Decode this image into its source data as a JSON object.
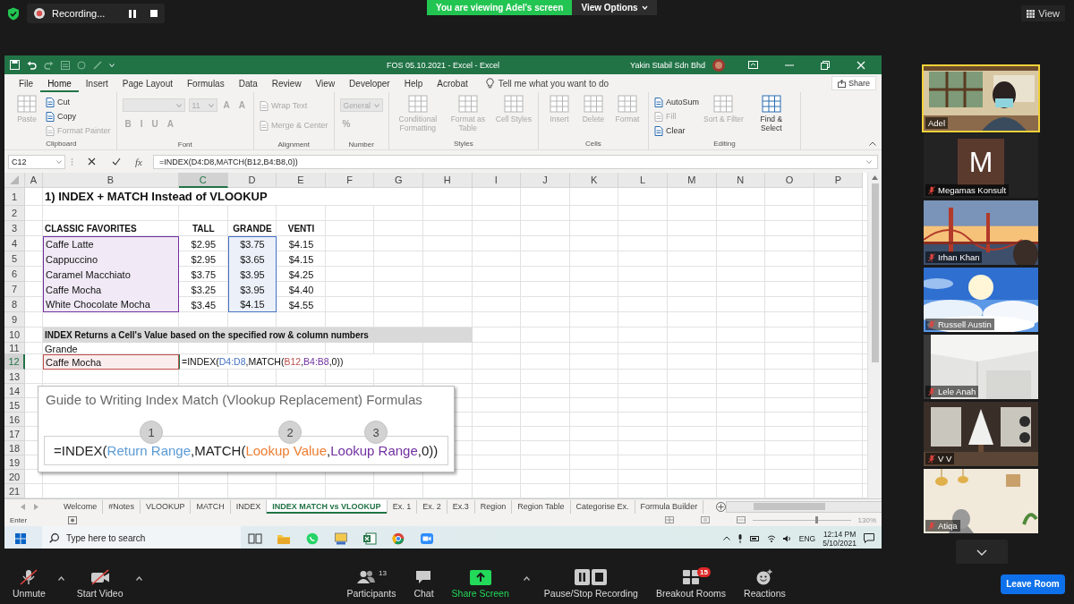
{
  "meeting_bar": {
    "recording_label": "Recording...",
    "viewing_banner": "You are viewing Adel's screen",
    "view_options": "View Options",
    "view_button": "View"
  },
  "excel": {
    "title": "FOS 05.10.2021 - Excel - Excel",
    "account": "Yakin Stabil Sdn Bhd",
    "menu_tabs": [
      {
        "label": "File",
        "selected": false
      },
      {
        "label": "Home",
        "selected": true
      },
      {
        "label": "Insert",
        "selected": false
      },
      {
        "label": "Page Layout",
        "selected": false
      },
      {
        "label": "Formulas",
        "selected": false
      },
      {
        "label": "Data",
        "selected": false
      },
      {
        "label": "Review",
        "selected": false
      },
      {
        "label": "View",
        "selected": false
      },
      {
        "label": "Developer",
        "selected": false
      },
      {
        "label": "Help",
        "selected": false
      },
      {
        "label": "Acrobat",
        "selected": false
      }
    ],
    "tell_me": "Tell me what you want to do",
    "share": "Share",
    "ribbon_groups": [
      {
        "name": "Clipboard",
        "items": [
          {
            "kind": "large",
            "label": "Paste",
            "disabled": true
          },
          {
            "kind": "small",
            "label": "Cut",
            "disabled": false
          },
          {
            "kind": "small",
            "label": "Copy",
            "disabled": false
          },
          {
            "kind": "small",
            "label": "Format Painter",
            "disabled": true
          }
        ]
      },
      {
        "name": "Font",
        "rows": [
          [
            {
              "kind": "field",
              "disabled": true
            },
            {
              "kind": "field",
              "value": "11",
              "disabled": true
            },
            {
              "kind": "glyph",
              "label": "A",
              "disabled": true
            },
            {
              "kind": "glyph",
              "label": "A",
              "disabled": true
            }
          ],
          [
            {
              "kind": "glyph",
              "label": "B",
              "disabled": true
            },
            {
              "kind": "glyph",
              "label": "I",
              "disabled": true
            },
            {
              "kind": "glyph",
              "label": "U",
              "disabled": true
            },
            {
              "kind": "glyph",
              "label": "A",
              "disabled": true
            }
          ]
        ]
      },
      {
        "name": "Alignment",
        "rows": [
          [
            {
              "kind": "small",
              "label": "Wrap Text",
              "disabled": true
            }
          ],
          [
            {
              "kind": "small",
              "label": "Merge & Center",
              "disabled": true
            }
          ]
        ]
      },
      {
        "name": "Number",
        "rows": [
          [
            {
              "kind": "field",
              "value": "General",
              "disabled": true
            }
          ],
          [
            {
              "kind": "glyph",
              "label": "%",
              "disabled": true
            }
          ]
        ]
      },
      {
        "name": "Styles",
        "items": [
          {
            "kind": "large",
            "label": "Conditional Formatting",
            "disabled": true
          },
          {
            "kind": "large",
            "label": "Format as Table",
            "disabled": true
          },
          {
            "kind": "large",
            "label": "Cell Styles",
            "disabled": true
          }
        ]
      },
      {
        "name": "Cells",
        "items": [
          {
            "kind": "large",
            "label": "Insert",
            "disabled": true
          },
          {
            "kind": "large",
            "label": "Delete",
            "disabled": true
          },
          {
            "kind": "large",
            "label": "Format",
            "disabled": true
          }
        ]
      },
      {
        "name": "Editing",
        "items": [
          {
            "kind": "small",
            "label": "AutoSum",
            "disabled": false
          },
          {
            "kind": "small",
            "label": "Fill",
            "disabled": true
          },
          {
            "kind": "small",
            "label": "Clear",
            "disabled": false
          },
          {
            "kind": "large",
            "label": "Sort & Filter",
            "disabled": true
          },
          {
            "kind": "large",
            "label": "Find & Select",
            "disabled": false
          }
        ]
      }
    ],
    "name_box": "C12",
    "function_label": "fx",
    "formula": "=INDEX(D4:D8,MATCH(B12,B4:B8,0))",
    "columns": [
      {
        "label": "A",
        "selected": false
      },
      {
        "label": "B",
        "selected": false
      },
      {
        "label": "C",
        "selected": true
      },
      {
        "label": "D",
        "selected": false
      },
      {
        "label": "E",
        "selected": false
      },
      {
        "label": "F",
        "selected": false
      },
      {
        "label": "G",
        "selected": false
      },
      {
        "label": "H",
        "selected": false
      },
      {
        "label": "I",
        "selected": false
      },
      {
        "label": "J",
        "selected": false
      },
      {
        "label": "K",
        "selected": false
      },
      {
        "label": "L",
        "selected": false
      },
      {
        "label": "M",
        "selected": false
      },
      {
        "label": "N",
        "selected": false
      },
      {
        "label": "O",
        "selected": false
      },
      {
        "label": "P",
        "selected": false
      }
    ],
    "rows": [
      {
        "label": "1",
        "selected": false,
        "cells": [
          "",
          {
            "kind": "title",
            "text": "1) INDEX + MATCH Instead of VLOOKUP"
          }
        ]
      },
      {
        "label": "2",
        "selected": false,
        "cells": []
      },
      {
        "label": "3",
        "selected": false,
        "cells": [
          "",
          {
            "kind": "heading",
            "text": "CLASSIC FAVORITES"
          },
          {
            "kind": "column-heading",
            "text": "TALL"
          },
          {
            "kind": "column-heading",
            "text": "GRANDE"
          },
          {
            "kind": "column-heading",
            "text": "VENTI"
          }
        ]
      },
      {
        "label": "4",
        "selected": false,
        "cells": [
          "",
          {
            "kind": "text",
            "text": "Caffe Latte",
            "color": "#7030a0"
          },
          {
            "kind": "number",
            "text": "$2.95"
          },
          {
            "kind": "number",
            "text": "$3.75",
            "color": "#4472c4"
          },
          {
            "kind": "number",
            "text": "$4.15"
          }
        ]
      },
      {
        "label": "5",
        "selected": false,
        "cells": [
          "",
          {
            "kind": "text",
            "text": "Cappuccino",
            "color": "#7030a0"
          },
          {
            "kind": "number",
            "text": "$2.95"
          },
          {
            "kind": "number",
            "text": "$3.65",
            "color": "#4472c4"
          },
          {
            "kind": "number",
            "text": "$4.15"
          }
        ]
      },
      {
        "label": "6",
        "selected": false,
        "cells": [
          "",
          {
            "kind": "text",
            "text": "Caramel Macchiato",
            "color": "#7030a0"
          },
          {
            "kind": "number",
            "text": "$3.75"
          },
          {
            "kind": "number",
            "text": "$3.95",
            "color": "#4472c4"
          },
          {
            "kind": "number",
            "text": "$4.25"
          }
        ]
      },
      {
        "label": "7",
        "selected": false,
        "cells": [
          "",
          {
            "kind": "text",
            "text": "Caffe Mocha",
            "color": "#7030a0"
          },
          {
            "kind": "number",
            "text": "$3.25"
          },
          {
            "kind": "number",
            "text": "$3.95",
            "color": "#4472c4"
          },
          {
            "kind": "number",
            "text": "$4.40"
          }
        ]
      },
      {
        "label": "8",
        "selected": false,
        "cells": [
          "",
          {
            "kind": "text",
            "text": "White Chocolate Mocha",
            "color": "#7030a0"
          },
          {
            "kind": "number",
            "text": "$3.45"
          },
          {
            "kind": "number",
            "text": "$4.15",
            "color": "#4472c4"
          },
          {
            "kind": "number",
            "text": "$4.55"
          }
        ]
      },
      {
        "label": "9",
        "selected": false,
        "cells": []
      },
      {
        "label": "10",
        "selected": false,
        "cells": [
          "",
          {
            "kind": "band",
            "text": "INDEX Returns a Cell's Value based on the specified row & column numbers"
          }
        ]
      },
      {
        "label": "11",
        "selected": false,
        "cells": [
          "",
          {
            "kind": "text",
            "text": "Grande"
          }
        ]
      },
      {
        "label": "12",
        "selected": true,
        "cells": [
          "",
          {
            "kind": "text",
            "text": "Caffe Mocha",
            "color": "#c0504d"
          },
          {
            "kind": "formula",
            "parts": [
              {
                "text": "=INDEX("
              },
              {
                "text": "D4:D8",
                "color": "#4472c4"
              },
              {
                "text": ",MATCH("
              },
              {
                "text": "B12",
                "color": "#c0504d"
              },
              {
                "text": ","
              },
              {
                "text": "B4:B8",
                "color": "#7030a0"
              },
              {
                "text": ",0))"
              }
            ]
          }
        ]
      },
      {
        "label": "13",
        "selected": false,
        "cells": []
      },
      {
        "label": "14",
        "selected": false,
        "cells": []
      },
      {
        "label": "15",
        "selected": false,
        "cells": []
      },
      {
        "label": "16",
        "selected": false,
        "cells": []
      },
      {
        "label": "17",
        "selected": false,
        "cells": []
      },
      {
        "label": "18",
        "selected": false,
        "cells": []
      },
      {
        "label": "19",
        "selected": false,
        "cells": []
      },
      {
        "label": "20",
        "selected": false,
        "cells": []
      },
      {
        "label": "21",
        "selected": false,
        "cells": []
      }
    ],
    "guide": {
      "title": "Guide to Writing Index Match (Vlookup Replacement) Formulas",
      "markers": [
        "1",
        "2",
        "3"
      ],
      "formula_parts": [
        {
          "text": "=INDEX("
        },
        {
          "text": "Return Range",
          "color": "#5b9bd5"
        },
        {
          "text": ",MATCH("
        },
        {
          "text": "Lookup Value",
          "color": "#ed7d31"
        },
        {
          "text": ","
        },
        {
          "text": "Lookup Range",
          "color": "#7030a0"
        },
        {
          "text": ",0))"
        }
      ]
    },
    "sheet_tabs": [
      {
        "label": "Welcome",
        "selected": false
      },
      {
        "label": "#Notes",
        "selected": false
      },
      {
        "label": "VLOOKUP",
        "selected": false
      },
      {
        "label": "MATCH",
        "selected": false
      },
      {
        "label": "INDEX",
        "selected": false
      },
      {
        "label": "INDEX MATCH vs VLOOKUP",
        "selected": true
      },
      {
        "label": "Ex. 1",
        "selected": false
      },
      {
        "label": "Ex. 2",
        "selected": false
      },
      {
        "label": "Ex.3",
        "selected": false
      },
      {
        "label": "Region",
        "selected": false
      },
      {
        "label": "Region Table",
        "selected": false
      },
      {
        "label": "Categorise Ex.",
        "selected": false
      },
      {
        "label": "Formula Builder",
        "selected": false
      }
    ],
    "status_mode": "Enter",
    "zoom_slider": {
      "level": 0.65
    },
    "zoom_level": "130%",
    "taskbar": {
      "search_placeholder": "Type here to search",
      "language": "ENG",
      "time": "12:14 PM",
      "date": "5/10/2021"
    }
  },
  "participants": [
    {
      "name": "Adel",
      "kind": "picture",
      "muted": false,
      "speaking": true
    },
    {
      "name": "Megamas Konsult",
      "kind": "avatar",
      "avatar_letter": "M",
      "muted": true,
      "speaking": false
    },
    {
      "name": "Irhan Khan",
      "kind": "picture",
      "muted": true,
      "speaking": false
    },
    {
      "name": "Russell Austin",
      "kind": "picture",
      "muted": true,
      "speaking": false
    },
    {
      "name": "Lele Anah",
      "kind": "picture",
      "muted": true,
      "speaking": false
    },
    {
      "name": "V V",
      "kind": "picture",
      "muted": true,
      "speaking": false
    },
    {
      "name": "Atiqa",
      "kind": "picture",
      "muted": true,
      "speaking": false
    }
  ],
  "toolbar": {
    "audio_video": [
      {
        "label": "Unmute",
        "kind": "mic",
        "off": true,
        "caret": true
      },
      {
        "label": "Start Video",
        "kind": "video",
        "off": true,
        "caret": true
      }
    ],
    "meeting_controls": [
      {
        "label": "Participants",
        "kind": "participants",
        "count": "13",
        "caret": false
      },
      {
        "label": "Chat",
        "kind": "chat",
        "caret": false
      },
      {
        "label": "Share Screen",
        "kind": "share",
        "caret": true
      },
      {
        "label": "Pause/Stop Recording",
        "kind": "recording",
        "caret": false
      },
      {
        "label": "Breakout Rooms",
        "kind": "breakout",
        "badge": "15",
        "caret": false
      },
      {
        "label": "Reactions",
        "kind": "reactions",
        "caret": false
      }
    ],
    "leave": "Leave Room"
  }
}
